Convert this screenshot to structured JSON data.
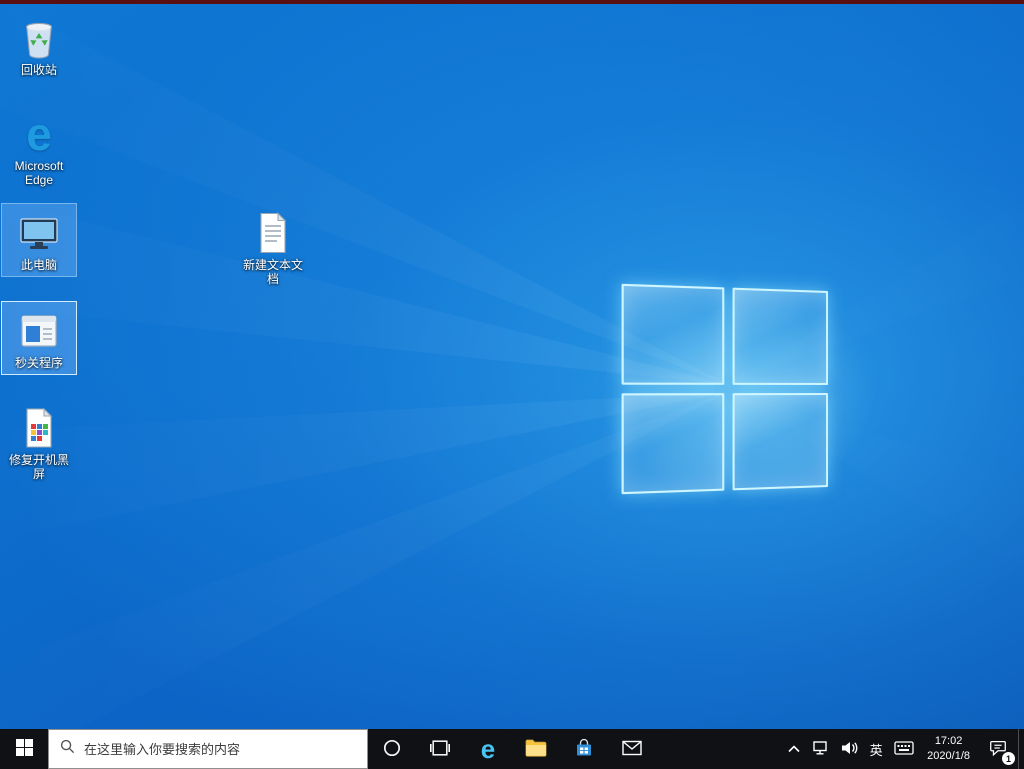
{
  "desktop": {
    "icons": [
      {
        "id": "recycle-bin",
        "label": "回收站"
      },
      {
        "id": "microsoft-edge",
        "label": "Microsoft Edge"
      },
      {
        "id": "this-pc",
        "label": "此电脑",
        "selected": true
      },
      {
        "id": "quick-close-app",
        "label": "秒关程序",
        "selected": true
      },
      {
        "id": "fix-boot-black-screen",
        "label": "修复开机黑屏"
      },
      {
        "id": "new-text-document",
        "label": "新建文本文档"
      }
    ]
  },
  "taskbar": {
    "search": {
      "placeholder": "在这里输入你要搜索的内容"
    },
    "buttons": [
      "start",
      "search",
      "cortana",
      "task-view",
      "edge",
      "file-explorer",
      "store",
      "mail"
    ],
    "tray": {
      "icons": [
        "tray-expand-chevron",
        "network",
        "volume",
        "ime-language",
        "ime-keyboard",
        "clock",
        "action-center",
        "show-desktop"
      ],
      "language_indicator": "英",
      "clock_time": "17:02",
      "clock_date": "2020/1/8",
      "notification_badge": "1"
    }
  },
  "glyphs": {
    "edge": "e"
  },
  "colors": {
    "wallpaper_base": "#0b63c6",
    "wallpaper_glow": "#2fb9f5",
    "taskbar_bg": "#101114",
    "accent_blue": "#0078d7",
    "selection_fill": "rgba(130,190,255,0.35)",
    "top_edge_line": "#5a1010"
  }
}
